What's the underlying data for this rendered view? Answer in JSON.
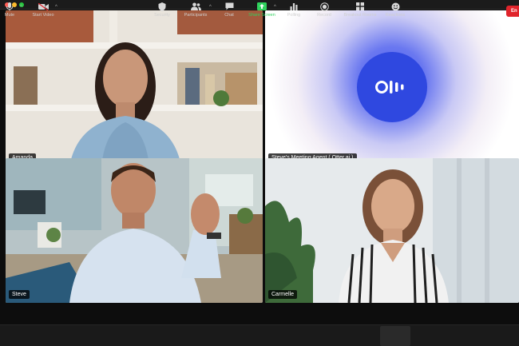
{
  "window": {
    "title": ""
  },
  "participants": [
    {
      "name": "Amanda",
      "active": false
    },
    {
      "name": "Steve's Meeting Agent ( Otter.ai )",
      "active": true
    },
    {
      "name": "Steve",
      "active": false
    },
    {
      "name": "Carmelle",
      "active": false
    }
  ],
  "toolbar": {
    "mute": "Mute",
    "start_video": "Start Video",
    "security": "Security",
    "participants": "Participants",
    "chat": "Chat",
    "share_screen": "Share Screen",
    "polling": "Polling",
    "record": "Record",
    "breakout_rooms": "Breakout Rooms",
    "reactions": "Reactions",
    "end": "En"
  },
  "colors": {
    "active_speaker": "#c6e24a",
    "share_screen": "#2fd15c",
    "end_button": "#e0242b",
    "otter_blue": "#2f48e0"
  },
  "icons": [
    "microphone-icon",
    "video-camera-icon",
    "shield-icon",
    "people-icon",
    "chat-bubble-icon",
    "share-screen-icon",
    "bar-chart-icon",
    "record-icon",
    "grid-icon",
    "smiley-icon",
    "otter-logo-icon"
  ]
}
